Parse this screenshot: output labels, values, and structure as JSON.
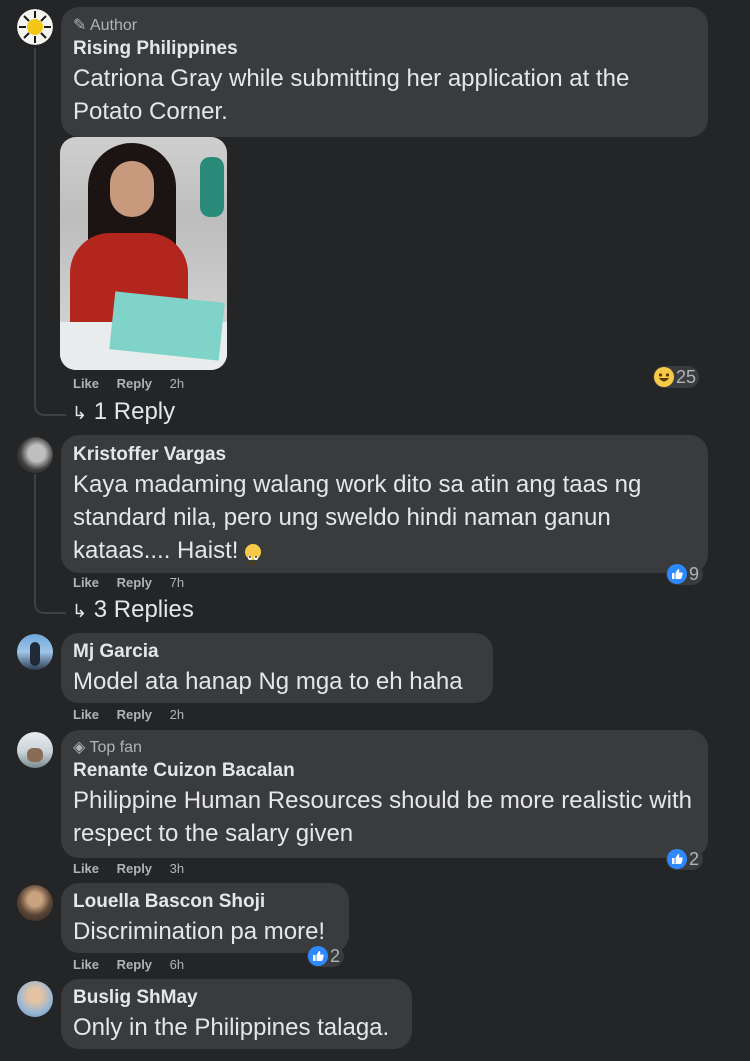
{
  "comments": [
    {
      "badge": "Author",
      "badge_icon": "pencil-icon",
      "name": "Rising Philippines",
      "text": "Catriona Gray while submitting her application at the Potato Corner.",
      "like": "Like",
      "reply": "Reply",
      "time": "2h",
      "reaction_icon": "haha-icon",
      "reaction_count": "25",
      "replies_label": "1 Reply"
    },
    {
      "name": "Kristoffer Vargas",
      "text": "Kaya madaming walang work dito sa atin ang taas ng standard nila, pero ung sweldo hindi naman ganun kataas.... Haist!",
      "emoji_icon": "eye-roll-emoji-icon",
      "like": "Like",
      "reply": "Reply",
      "time": "7h",
      "reaction_icon": "like-icon",
      "reaction_count": "9",
      "replies_label": "3 Replies"
    },
    {
      "name": "Mj Garcia",
      "text": "Model ata hanap Ng mga to eh haha",
      "like": "Like",
      "reply": "Reply",
      "time": "2h"
    },
    {
      "badge": "Top fan",
      "badge_icon": "diamond-icon",
      "name": "Renante Cuizon Bacalan",
      "text": "Philippine Human Resources should be more realistic with respect to the salary given",
      "like": "Like",
      "reply": "Reply",
      "time": "3h",
      "reaction_icon": "like-icon",
      "reaction_count": "2"
    },
    {
      "name": "Louella Bascon Shoji",
      "text": "Discrimination pa more!",
      "like": "Like",
      "reply": "Reply",
      "time": "6h",
      "reaction_icon": "like-icon",
      "reaction_count": "2"
    },
    {
      "name": "Buslig ShMay",
      "text": "Only in the Philippines talaga."
    }
  ],
  "colors": {
    "background": "#242526",
    "bubble": "#3a3b3c",
    "text": "#e4e6eb",
    "secondary_text": "#b0b3b8",
    "like_blue": "#2e89ff"
  }
}
